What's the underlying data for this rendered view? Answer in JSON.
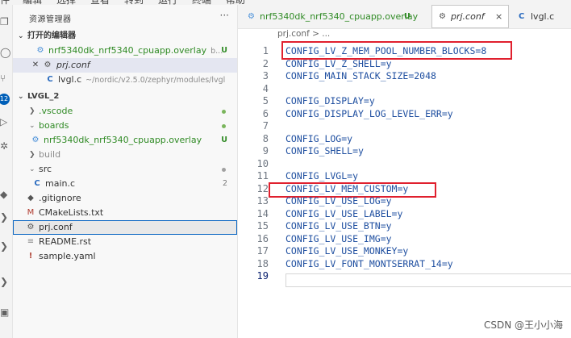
{
  "menubar": {
    "items": [
      "件",
      "编辑",
      "选择",
      "查看",
      "转到",
      "运行",
      "终端",
      "帮助"
    ]
  },
  "activity": {
    "badge_count": "12"
  },
  "sidebar": {
    "title": "资源管理器",
    "more_label": "···",
    "open_editors": {
      "header": "打开的编辑器",
      "items": [
        {
          "name": "nrf5340dk_nrf5340_cpuapp.overlay",
          "desc": "b...",
          "deco": "U"
        },
        {
          "name": "prj.conf",
          "desc": "",
          "deco": ""
        },
        {
          "name": "lvgl.c",
          "desc": "~/nordic/v2.5.0/zephyr/modules/lvgl",
          "deco": ""
        }
      ]
    },
    "project": {
      "header": "LVGL_2",
      "items": [
        {
          "name": ".vscode"
        },
        {
          "name": "boards"
        },
        {
          "name": "nrf5340dk_nrf5340_cpuapp.overlay",
          "deco": "U"
        },
        {
          "name": "build"
        },
        {
          "name": "src"
        },
        {
          "name": "main.c",
          "deco": "2"
        },
        {
          "name": ".gitignore"
        },
        {
          "name": "CMakeLists.txt"
        },
        {
          "name": "prj.conf"
        },
        {
          "name": "README.rst"
        },
        {
          "name": "sample.yaml"
        }
      ]
    }
  },
  "tabs": [
    {
      "label": "nrf5340dk_nrf5340_cpuapp.overlay",
      "mod": "U"
    },
    {
      "label": "prj.conf",
      "close": "×"
    },
    {
      "label": "lvgl.c"
    }
  ],
  "breadcrumb": "prj.conf > ...",
  "editor": {
    "lines": [
      {
        "n": "1",
        "text": "CONFIG_LV_Z_MEM_POOL_NUMBER_BLOCKS=8"
      },
      {
        "n": "2",
        "text": "CONFIG_LV_Z_SHELL=y"
      },
      {
        "n": "3",
        "text": "CONFIG_MAIN_STACK_SIZE=2048"
      },
      {
        "n": "4",
        "text": ""
      },
      {
        "n": "5",
        "text": "CONFIG_DISPLAY=y"
      },
      {
        "n": "6",
        "text": "CONFIG_DISPLAY_LOG_LEVEL_ERR=y"
      },
      {
        "n": "7",
        "text": ""
      },
      {
        "n": "8",
        "text": "CONFIG_LOG=y"
      },
      {
        "n": "9",
        "text": "CONFIG_SHELL=y"
      },
      {
        "n": "10",
        "text": ""
      },
      {
        "n": "11",
        "text": "CONFIG_LVGL=y"
      },
      {
        "n": "12",
        "text": "CONFIG_LV_MEM_CUSTOM=y"
      },
      {
        "n": "13",
        "text": "CONFIG_LV_USE_LOG=y"
      },
      {
        "n": "14",
        "text": "CONFIG_LV_USE_LABEL=y"
      },
      {
        "n": "15",
        "text": "CONFIG_LV_USE_BTN=y"
      },
      {
        "n": "16",
        "text": "CONFIG_LV_USE_IMG=y"
      },
      {
        "n": "17",
        "text": "CONFIG_LV_USE_MONKEY=y"
      },
      {
        "n": "18",
        "text": "CONFIG_LV_FONT_MONTSERRAT_14=y"
      },
      {
        "n": "19",
        "text": ""
      }
    ]
  },
  "watermark": "CSDN @王小小海",
  "colors": {
    "highlight": "#e0202e",
    "accent": "#005fb8",
    "untracked": "#2f8a24"
  }
}
